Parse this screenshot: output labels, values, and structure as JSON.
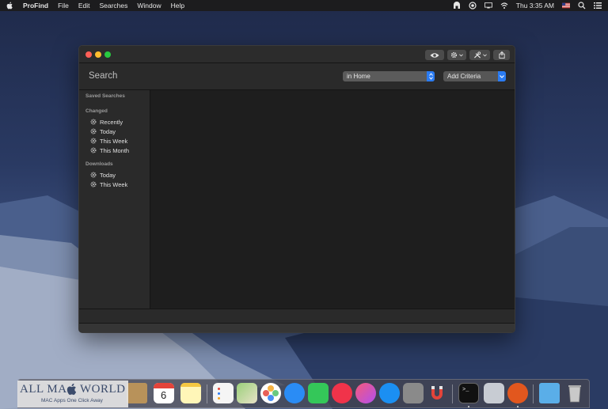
{
  "menubar": {
    "app_name": "ProFind",
    "items": [
      "File",
      "Edit",
      "Searches",
      "Window",
      "Help"
    ],
    "clock": "Thu 3:35 AM",
    "status_icons": [
      "user-icon",
      "record-icon",
      "display-icon",
      "wifi-icon",
      "flag-us-icon",
      "search-icon",
      "list-icon"
    ]
  },
  "window": {
    "toolbar_icons": [
      "eye-icon",
      "gear-icon",
      "tools-icon",
      "share-icon"
    ],
    "search_label": "Search",
    "scope_value": "in Home",
    "criteria_label": "Add Criteria",
    "sidebar": {
      "saved_searches": "Saved Searches",
      "changed_heading": "Changed",
      "changed_items": [
        "Recently",
        "Today",
        "This Week",
        "This Month"
      ],
      "downloads_heading": "Downloads",
      "downloads_items": [
        "Today",
        "This Week"
      ]
    }
  },
  "watermark": {
    "title_left": "ALL MA",
    "title_right": "WORLD",
    "subtitle": "MAC Apps One Click Away"
  },
  "dock": {
    "calendar_day": "6",
    "icons": [
      "finder-icon",
      "notes-paper-icon",
      "calendar-icon",
      "notes-icon",
      "reminders-icon",
      "maps-icon",
      "photos-icon",
      "messages-icon",
      "facetime-icon",
      "news-icon",
      "music-icon",
      "app-store-icon",
      "system-preferences-icon",
      "magnet-icon",
      "terminal-icon",
      "preview-icon",
      "profind-icon",
      "folder-icon",
      "trash-icon"
    ]
  },
  "colors": {
    "accent": "#2a7bf2",
    "window_bg": "#1e1e1e",
    "sidebar_bg": "#2a2a2a"
  }
}
